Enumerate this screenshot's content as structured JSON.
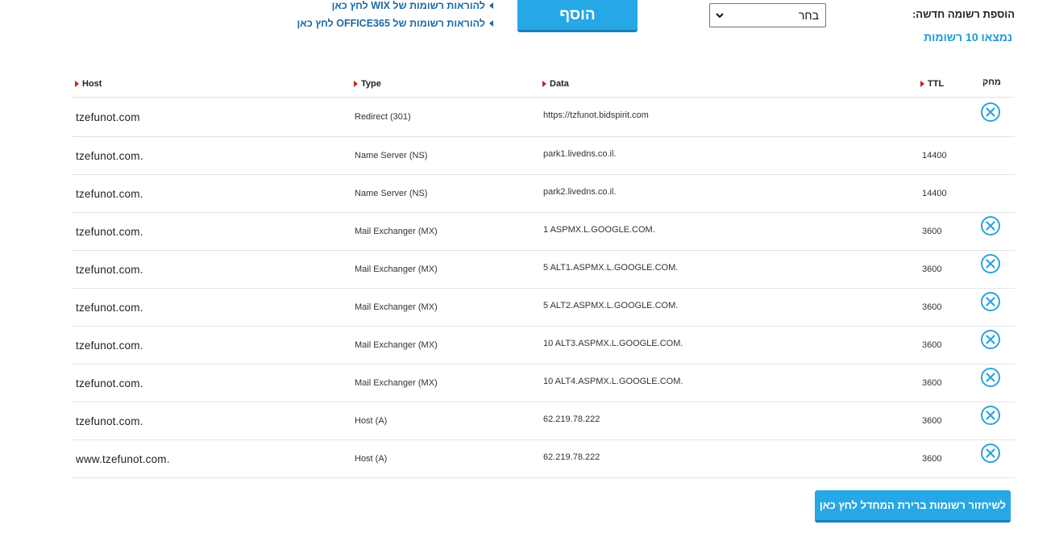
{
  "top": {
    "add_record_label": "הוספת רשומה חדשה:",
    "found_count": "נמצאו 10 רשומות",
    "record_type_select": {
      "selected": "בחר"
    },
    "add_button_label": "הוסף",
    "wix_link": "להוראות רשומות של WIX לחץ כאן",
    "office365_link": "להוראות רשומות של OFFICE365 לחץ כאן"
  },
  "table": {
    "headers": {
      "host": "Host",
      "type": "Type",
      "data": "Data",
      "ttl": "TTL",
      "delete": "מחק"
    },
    "rows": [
      {
        "host": "tzefunot.com",
        "type": "Redirect (301)",
        "data": "https://tzfunot.bidspirit.com",
        "ttl": "",
        "deletable": true
      },
      {
        "host": "tzefunot.com.",
        "type": "Name Server (NS)",
        "data": "park1.livedns.co.il.",
        "ttl": "14400",
        "deletable": false
      },
      {
        "host": "tzefunot.com.",
        "type": "Name Server (NS)",
        "data": "park2.livedns.co.il.",
        "ttl": "14400",
        "deletable": false
      },
      {
        "host": "tzefunot.com.",
        "type": "Mail Exchanger (MX)",
        "data": "1 ASPMX.L.GOOGLE.COM.",
        "ttl": "3600",
        "deletable": true
      },
      {
        "host": "tzefunot.com.",
        "type": "Mail Exchanger (MX)",
        "data": "5 ALT1.ASPMX.L.GOOGLE.COM.",
        "ttl": "3600",
        "deletable": true
      },
      {
        "host": "tzefunot.com.",
        "type": "Mail Exchanger (MX)",
        "data": "5 ALT2.ASPMX.L.GOOGLE.COM.",
        "ttl": "3600",
        "deletable": true
      },
      {
        "host": "tzefunot.com.",
        "type": "Mail Exchanger (MX)",
        "data": "10 ALT3.ASPMX.L.GOOGLE.COM.",
        "ttl": "3600",
        "deletable": true
      },
      {
        "host": "tzefunot.com.",
        "type": "Mail Exchanger (MX)",
        "data": "10 ALT4.ASPMX.L.GOOGLE.COM.",
        "ttl": "3600",
        "deletable": true
      },
      {
        "host": "tzefunot.com.",
        "type": "Host (A)",
        "data": "62.219.78.222",
        "ttl": "3600",
        "deletable": true
      },
      {
        "host": "www.tzefunot.com.",
        "type": "Host (A)",
        "data": "62.219.78.222",
        "ttl": "3600",
        "deletable": true
      }
    ]
  },
  "restore_button_label": "לשיחזור רשומות ברירת המחדל לחץ כאן",
  "colors": {
    "accent": "#26a7e6",
    "link": "#1b6aa3",
    "sort_arrow": "#cc1f1f",
    "delete_icon": "#2aa3dc"
  },
  "icons": {
    "delete": "close-circle-icon",
    "sort": "triangle-right-icon",
    "link_marker": "triangle-left-icon",
    "select": "chevron-down-icon"
  }
}
